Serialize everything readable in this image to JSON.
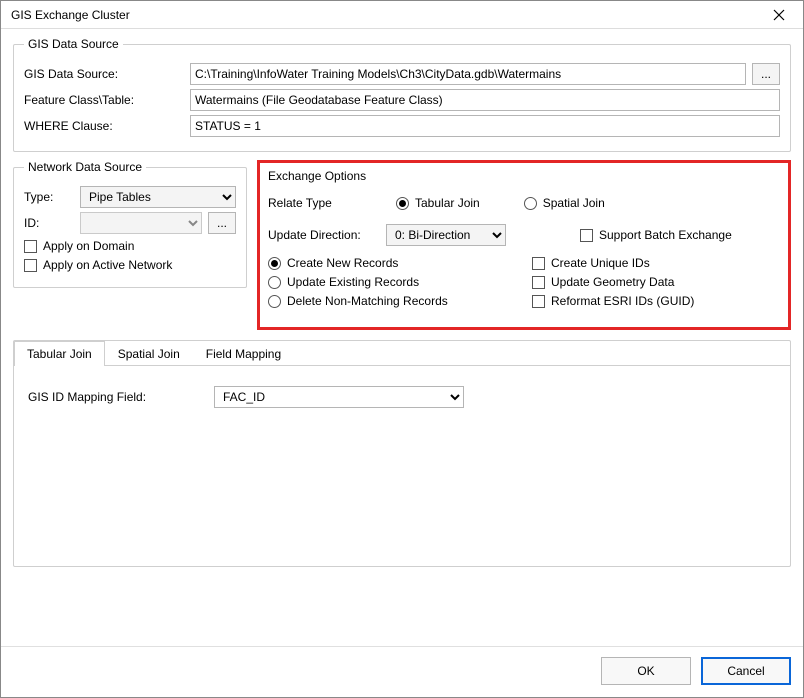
{
  "window": {
    "title": "GIS Exchange Cluster"
  },
  "gisDataSource": {
    "legend": "GIS Data Source",
    "sourceLabel": "GIS Data Source:",
    "sourceValue": "C:\\Training\\InfoWater Training Models\\Ch3\\CityData.gdb\\Watermains",
    "featureLabel": "Feature Class\\Table:",
    "featureValue": "Watermains (File Geodatabase Feature Class)",
    "whereLabel": "WHERE Clause:",
    "whereValue": "STATUS = 1",
    "browse": "..."
  },
  "networkDataSource": {
    "legend": "Network Data Source",
    "typeLabel": "Type:",
    "typeValue": "Pipe Tables",
    "idLabel": "ID:",
    "idValue": "",
    "browse": "...",
    "applyDomain": "Apply on Domain",
    "applyActive": "Apply on Active Network"
  },
  "exchangeOptions": {
    "legend": "Exchange Options",
    "relateTypeLabel": "Relate Type",
    "tabularJoin": "Tabular Join",
    "spatialJoin": "Spatial Join",
    "updateDirectionLabel": "Update Direction:",
    "updateDirectionValue": "0: Bi-Direction",
    "createNew": "Create New Records",
    "updateExisting": "Update Existing Records",
    "deleteNonMatching": "Delete Non-Matching Records",
    "supportBatch": "Support Batch Exchange",
    "createUnique": "Create Unique IDs",
    "updateGeometry": "Update Geometry Data",
    "reformatEsri": "Reformat ESRI IDs (GUID)"
  },
  "tabs": {
    "tabularJoin": "Tabular Join",
    "spatialJoin": "Spatial Join",
    "fieldMapping": "Field Mapping",
    "mappingLabel": "GIS ID Mapping Field:",
    "mappingValue": "FAC_ID"
  },
  "footer": {
    "ok": "OK",
    "cancel": "Cancel"
  }
}
